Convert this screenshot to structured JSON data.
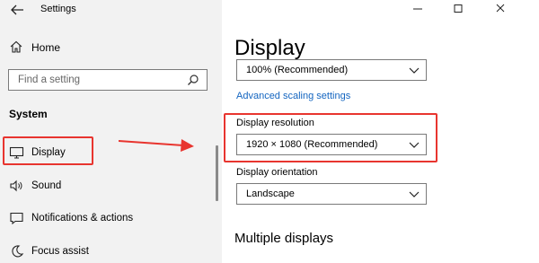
{
  "window": {
    "title": "Settings",
    "controls": {
      "minimize_icon": "minimize-icon",
      "maximize_icon": "maximize-icon",
      "close_icon": "close-icon"
    }
  },
  "sidebar": {
    "home_label": "Home",
    "search_placeholder": "Find a setting",
    "section_title": "System",
    "items": [
      {
        "label": "Display",
        "icon": "monitor-icon",
        "selected": true
      },
      {
        "label": "Sound",
        "icon": "speaker-icon",
        "selected": false
      },
      {
        "label": "Notifications & actions",
        "icon": "notification-icon",
        "selected": false
      },
      {
        "label": "Focus assist",
        "icon": "moon-icon",
        "selected": false
      }
    ]
  },
  "main": {
    "title": "Display",
    "scaling_value": "100% (Recommended)",
    "advanced_scaling_link": "Advanced scaling settings",
    "resolution": {
      "label": "Display resolution",
      "value": "1920 × 1080 (Recommended)"
    },
    "orientation": {
      "label": "Display orientation",
      "value": "Landscape"
    },
    "multiple_displays_heading": "Multiple displays"
  },
  "colors": {
    "highlight": "#e8352f",
    "link": "#1465c0",
    "sidebar_bg": "#f2f2f2"
  }
}
